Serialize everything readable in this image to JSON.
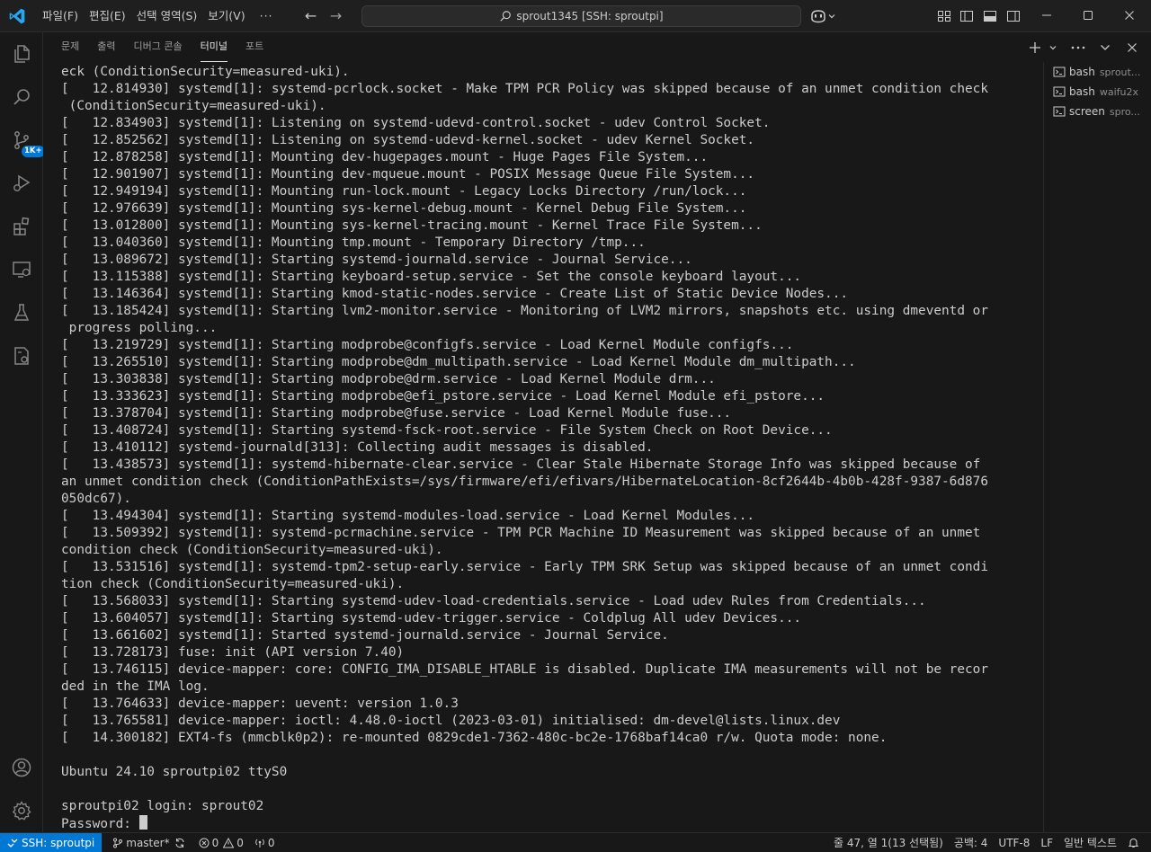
{
  "titlebar": {
    "menus": [
      "파일(F)",
      "편집(E)",
      "선택 영역(S)",
      "보기(V)"
    ],
    "more": "···",
    "search_text": "sprout1345 [SSH: sproutpi]"
  },
  "activity": {
    "scm_badge": "1K+"
  },
  "panel": {
    "tabs": [
      "문제",
      "출력",
      "디버그 콘솔",
      "터미널",
      "포트"
    ],
    "active_tab": "터미널"
  },
  "terminal": {
    "lines": [
      "eck (ConditionSecurity=measured-uki).",
      "[   12.814930] systemd[1]: systemd-pcrlock.socket - Make TPM PCR Policy was skipped because of an unmet condition check",
      " (ConditionSecurity=measured-uki).",
      "[   12.834903] systemd[1]: Listening on systemd-udevd-control.socket - udev Control Socket.",
      "[   12.852562] systemd[1]: Listening on systemd-udevd-kernel.socket - udev Kernel Socket.",
      "[   12.878258] systemd[1]: Mounting dev-hugepages.mount - Huge Pages File System...",
      "[   12.901907] systemd[1]: Mounting dev-mqueue.mount - POSIX Message Queue File System...",
      "[   12.949194] systemd[1]: Mounting run-lock.mount - Legacy Locks Directory /run/lock...",
      "[   12.976639] systemd[1]: Mounting sys-kernel-debug.mount - Kernel Debug File System...",
      "[   13.012800] systemd[1]: Mounting sys-kernel-tracing.mount - Kernel Trace File System...",
      "[   13.040360] systemd[1]: Mounting tmp.mount - Temporary Directory /tmp...",
      "[   13.089672] systemd[1]: Starting systemd-journald.service - Journal Service...",
      "[   13.115388] systemd[1]: Starting keyboard-setup.service - Set the console keyboard layout...",
      "[   13.146364] systemd[1]: Starting kmod-static-nodes.service - Create List of Static Device Nodes...",
      "[   13.185424] systemd[1]: Starting lvm2-monitor.service - Monitoring of LVM2 mirrors, snapshots etc. using dmeventd or",
      " progress polling...",
      "[   13.219729] systemd[1]: Starting modprobe@configfs.service - Load Kernel Module configfs...",
      "[   13.265510] systemd[1]: Starting modprobe@dm_multipath.service - Load Kernel Module dm_multipath...",
      "[   13.303838] systemd[1]: Starting modprobe@drm.service - Load Kernel Module drm...",
      "[   13.333623] systemd[1]: Starting modprobe@efi_pstore.service - Load Kernel Module efi_pstore...",
      "[   13.378704] systemd[1]: Starting modprobe@fuse.service - Load Kernel Module fuse...",
      "[   13.408724] systemd[1]: Starting systemd-fsck-root.service - File System Check on Root Device...",
      "[   13.410112] systemd-journald[313]: Collecting audit messages is disabled.",
      "[   13.438573] systemd[1]: systemd-hibernate-clear.service - Clear Stale Hibernate Storage Info was skipped because of",
      "an unmet condition check (ConditionPathExists=/sys/firmware/efi/efivars/HibernateLocation-8cf2644b-4b0b-428f-9387-6d876",
      "050dc67).",
      "[   13.494304] systemd[1]: Starting systemd-modules-load.service - Load Kernel Modules...",
      "[   13.509392] systemd[1]: systemd-pcrmachine.service - TPM PCR Machine ID Measurement was skipped because of an unmet",
      "condition check (ConditionSecurity=measured-uki).",
      "[   13.531516] systemd[1]: systemd-tpm2-setup-early.service - Early TPM SRK Setup was skipped because of an unmet condi",
      "tion check (ConditionSecurity=measured-uki).",
      "[   13.568033] systemd[1]: Starting systemd-udev-load-credentials.service - Load udev Rules from Credentials...",
      "[   13.604057] systemd[1]: Starting systemd-udev-trigger.service - Coldplug All udev Devices...",
      "[   13.661602] systemd[1]: Started systemd-journald.service - Journal Service.",
      "[   13.728173] fuse: init (API version 7.40)",
      "[   13.746115] device-mapper: core: CONFIG_IMA_DISABLE_HTABLE is disabled. Duplicate IMA measurements will not be recor",
      "ded in the IMA log.",
      "[   13.764633] device-mapper: uevent: version 1.0.3",
      "[   13.765581] device-mapper: ioctl: 4.48.0-ioctl (2023-03-01) initialised: dm-devel@lists.linux.dev",
      "[   14.300182] EXT4-fs (mmcblk0p2): re-mounted 0829cde1-7362-480c-bc2e-1768baf14ca0 r/w. Quota mode: none.",
      "",
      "Ubuntu 24.10 sproutpi02 ttyS0",
      "",
      "sproutpi02 login: sprout02"
    ],
    "prompt": "Password: "
  },
  "terminals": [
    {
      "name": "bash",
      "desc": "sprout..."
    },
    {
      "name": "bash",
      "desc": "waifu2x"
    },
    {
      "name": "screen",
      "desc": "spro..."
    }
  ],
  "statusbar": {
    "remote": "SSH: sproutpi",
    "branch": "master*",
    "errors": "0",
    "warnings": "0",
    "ports": "0",
    "position": "줄 47, 열 1(13 선택됨)",
    "spaces": "공백: 4",
    "encoding": "UTF-8",
    "eol": "LF",
    "language": "일반 텍스트"
  },
  "colors": {
    "accent": "#0078d4",
    "background": "#181818",
    "titlebar": "#1f1f1f"
  }
}
